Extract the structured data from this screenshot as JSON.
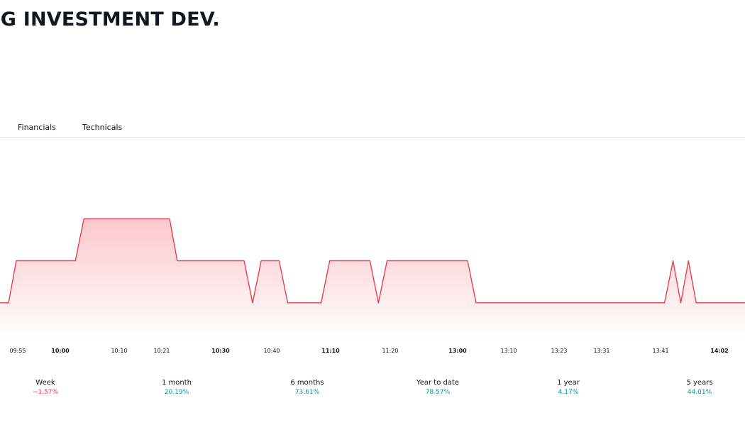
{
  "header": {
    "title": "NG INVESTMENT DEV."
  },
  "tabs": [
    {
      "label": "Financials"
    },
    {
      "label": "Technicals"
    }
  ],
  "colors": {
    "line": "#e5414f",
    "fill_top": "#fdc7cb",
    "fill_bottom": "#ffffff",
    "positive": "#089981",
    "negative": "#f23645"
  },
  "chart_data": {
    "type": "area",
    "x_ticks": [
      {
        "label": "09:55",
        "bold": false
      },
      {
        "label": "10:00",
        "bold": true
      },
      {
        "label": "10:10",
        "bold": false
      },
      {
        "label": "10:21",
        "bold": false
      },
      {
        "label": "10:30",
        "bold": true
      },
      {
        "label": "10:40",
        "bold": false
      },
      {
        "label": "11:10",
        "bold": true
      },
      {
        "label": "11:20",
        "bold": false
      },
      {
        "label": "13:00",
        "bold": true
      },
      {
        "label": "13:10",
        "bold": false
      },
      {
        "label": "13:23",
        "bold": false
      },
      {
        "label": "13:31",
        "bold": false
      },
      {
        "label": "13:41",
        "bold": false
      },
      {
        "label": "14:02",
        "bold": true
      }
    ],
    "y_axis_labels_visible": false,
    "ylim": [
      0,
      4
    ],
    "series": [
      {
        "values": [
          [
            0,
            1
          ],
          [
            1.0,
            1
          ],
          [
            1.9,
            2
          ],
          [
            8.8,
            2
          ],
          [
            9.8,
            3
          ],
          [
            19.8,
            3
          ],
          [
            20.7,
            2
          ],
          [
            28.5,
            2
          ],
          [
            29.5,
            1
          ],
          [
            30.5,
            2
          ],
          [
            32.6,
            2
          ],
          [
            33.6,
            1
          ],
          [
            37.5,
            1
          ],
          [
            38.5,
            2
          ],
          [
            43.2,
            2
          ],
          [
            44.2,
            1
          ],
          [
            45.2,
            2
          ],
          [
            54.6,
            2
          ],
          [
            55.6,
            1
          ],
          [
            77.6,
            1
          ],
          [
            78.6,
            2
          ],
          [
            79.5,
            1
          ],
          [
            80.4,
            2
          ],
          [
            81.3,
            1
          ],
          [
            87.0,
            1
          ]
        ]
      }
    ]
  },
  "performance": [
    {
      "label": "Week",
      "value": "−1.57%",
      "direction": "down"
    },
    {
      "label": "1 month",
      "value": "20.19%",
      "direction": "up"
    },
    {
      "label": "6 months",
      "value": "73.61%",
      "direction": "up"
    },
    {
      "label": "Year to date",
      "value": "78.57%",
      "direction": "up"
    },
    {
      "label": "1 year",
      "value": "4.17%",
      "direction": "up"
    },
    {
      "label": "5 years",
      "value": "44.01%",
      "direction": "up"
    }
  ]
}
